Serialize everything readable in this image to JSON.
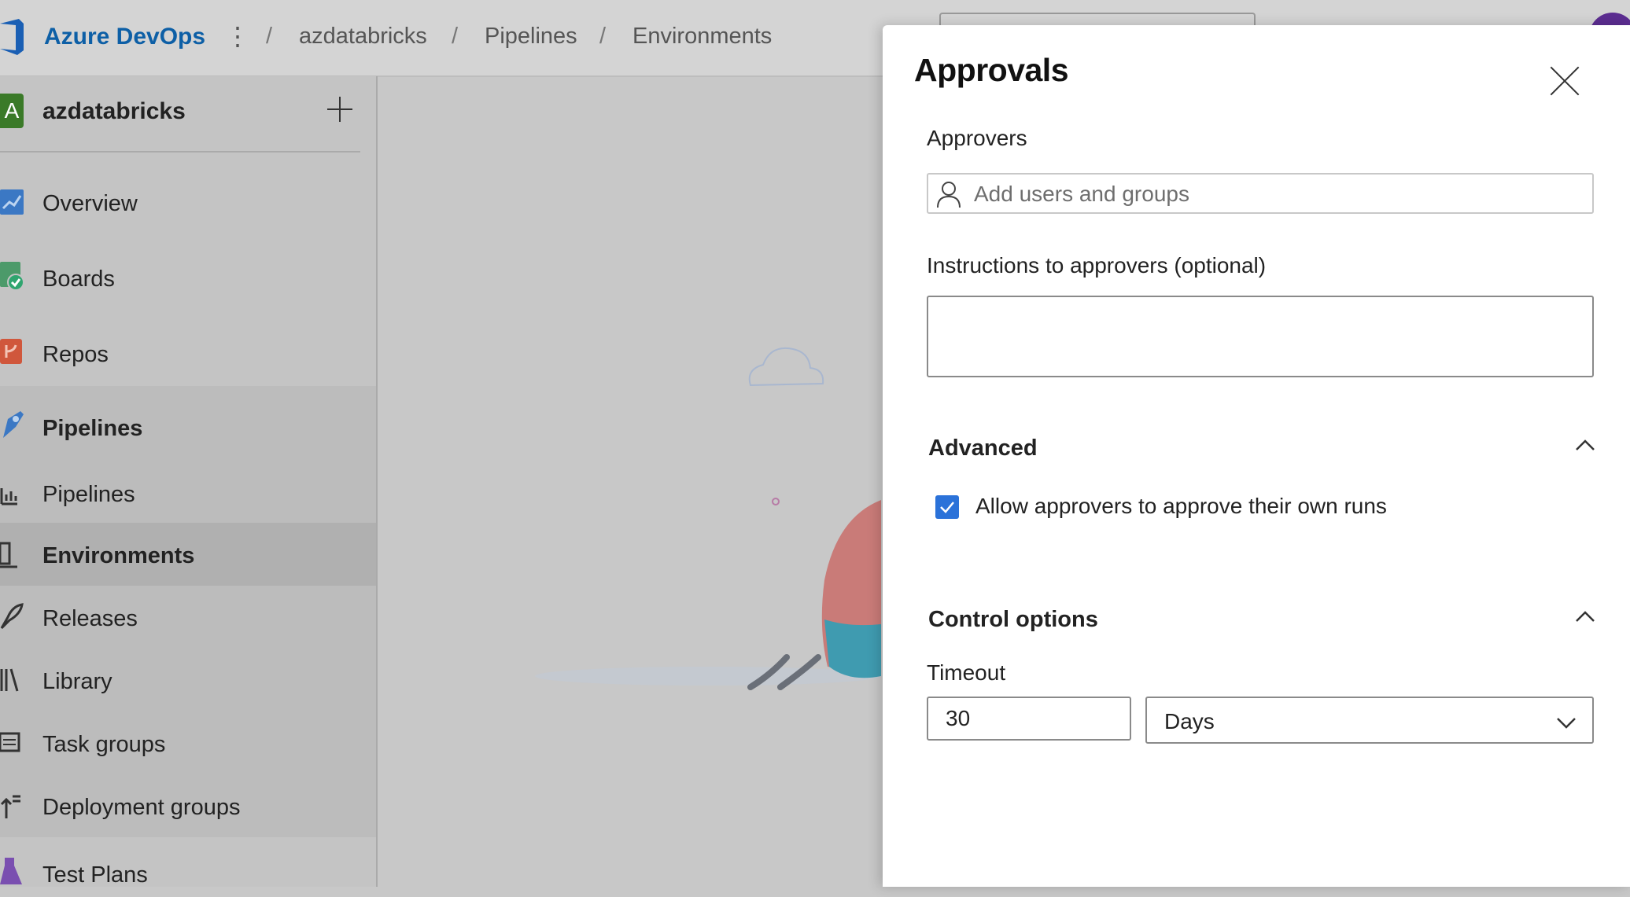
{
  "header": {
    "brand": "Azure DevOps",
    "breadcrumbs": [
      "azdatabricks",
      "Pipelines",
      "Environments"
    ],
    "separator": "/"
  },
  "sidebar": {
    "project_initial": "A",
    "project_name": "azdatabricks",
    "items": [
      {
        "label": "Overview",
        "icon": "overview-icon"
      },
      {
        "label": "Boards",
        "icon": "boards-icon"
      },
      {
        "label": "Repos",
        "icon": "repos-icon"
      },
      {
        "label": "Pipelines",
        "icon": "pipelines-icon"
      },
      {
        "label": "Pipelines",
        "icon": "pipeline-sub-icon"
      },
      {
        "label": "Environments",
        "icon": "environments-icon"
      },
      {
        "label": "Releases",
        "icon": "releases-icon"
      },
      {
        "label": "Library",
        "icon": "library-icon"
      },
      {
        "label": "Task groups",
        "icon": "task-groups-icon"
      },
      {
        "label": "Deployment groups",
        "icon": "deployment-groups-icon"
      },
      {
        "label": "Test Plans",
        "icon": "test-plans-icon"
      }
    ]
  },
  "panel": {
    "title": "Approvals",
    "approvers_label": "Approvers",
    "approvers_placeholder": "Add users and groups",
    "approvers_value": "",
    "instructions_label": "Instructions to approvers (optional)",
    "instructions_value": "",
    "advanced_title": "Advanced",
    "allow_own_runs_label": "Allow approvers to approve their own runs",
    "allow_own_runs_checked": true,
    "control_title": "Control options",
    "timeout_label": "Timeout",
    "timeout_value": "30",
    "timeout_unit": "Days"
  },
  "colors": {
    "brand": "#0d5fa6",
    "checkbox": "#2b72d9",
    "overlay": "#c8c8c8"
  }
}
